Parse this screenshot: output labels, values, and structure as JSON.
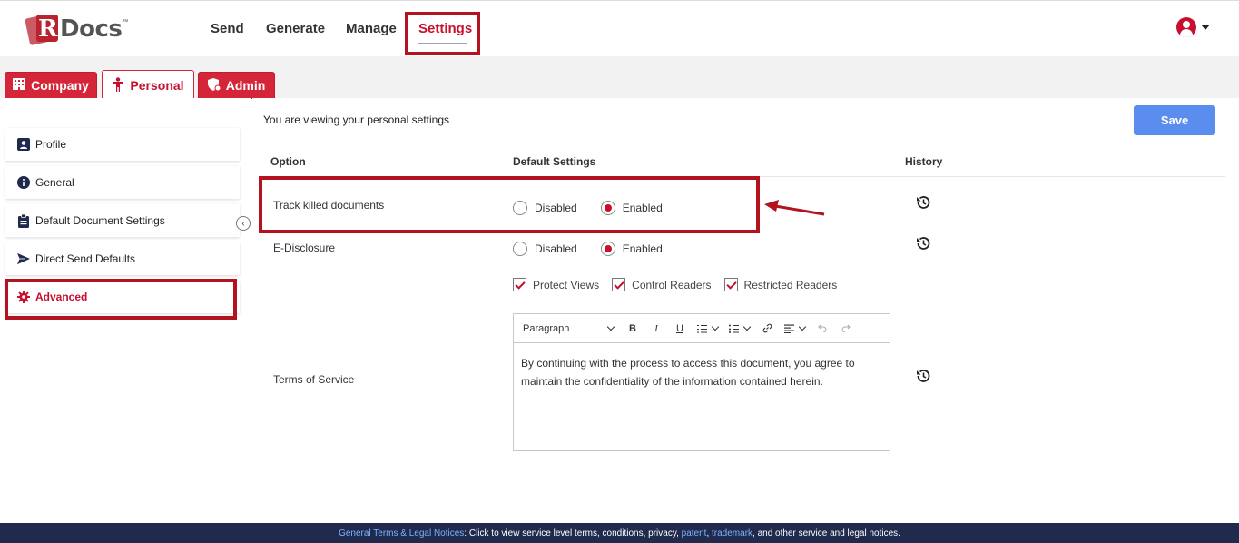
{
  "header": {
    "logo": {
      "letter": "R",
      "text": "Docs",
      "tm": "™"
    },
    "nav": [
      {
        "label": "Send"
      },
      {
        "label": "Generate"
      },
      {
        "label": "Manage"
      },
      {
        "label": "Settings",
        "active": true
      }
    ],
    "user_icon": "user-circle-icon"
  },
  "tabs": [
    {
      "label": "Company",
      "icon": "building-icon"
    },
    {
      "label": "Personal",
      "icon": "person-icon",
      "active": true
    },
    {
      "label": "Admin",
      "icon": "shield-icon"
    }
  ],
  "sidebar": {
    "items": [
      {
        "label": "Profile",
        "icon": "profile-card-icon"
      },
      {
        "label": "General",
        "icon": "info-icon"
      },
      {
        "label": "Default Document Settings",
        "icon": "clipboard-icon"
      },
      {
        "label": "Direct Send Defaults",
        "icon": "send-icon"
      },
      {
        "label": "Advanced",
        "icon": "gear-icon",
        "active": true
      }
    ]
  },
  "main": {
    "title": "You are viewing your personal settings",
    "save_label": "Save",
    "columns": {
      "option": "Option",
      "default": "Default Settings",
      "history": "History"
    },
    "rows": [
      {
        "label": "Track killed documents",
        "options": [
          "Disabled",
          "Enabled"
        ],
        "selected": "Enabled"
      },
      {
        "label": "E-Disclosure",
        "options": [
          "Disabled",
          "Enabled"
        ],
        "selected": "Enabled"
      }
    ],
    "checkboxes": [
      {
        "label": "Protect Views",
        "checked": true
      },
      {
        "label": "Control Readers",
        "checked": true
      },
      {
        "label": "Restricted Readers",
        "checked": true
      }
    ],
    "terms": {
      "label": "Terms of Service",
      "toolbar": {
        "paragraph": "Paragraph",
        "bold": "B",
        "italic": "I",
        "underline": "U"
      },
      "body": "By continuing with the process to access this document, you agree to maintain the confidentiality of the information contained herein."
    }
  },
  "footer": {
    "link1": "General Terms & Legal Notices",
    "text1": ": Click to view service level terms, conditions, privacy, ",
    "link2": "patent",
    "sep": ", ",
    "link3": "trademark",
    "text2": ", and other service and legal notices."
  },
  "colors": {
    "brand_red": "#c8102e",
    "save_blue": "#5b8def",
    "footer_navy": "#1f2a4d",
    "highlight_box": "#b3121f"
  }
}
